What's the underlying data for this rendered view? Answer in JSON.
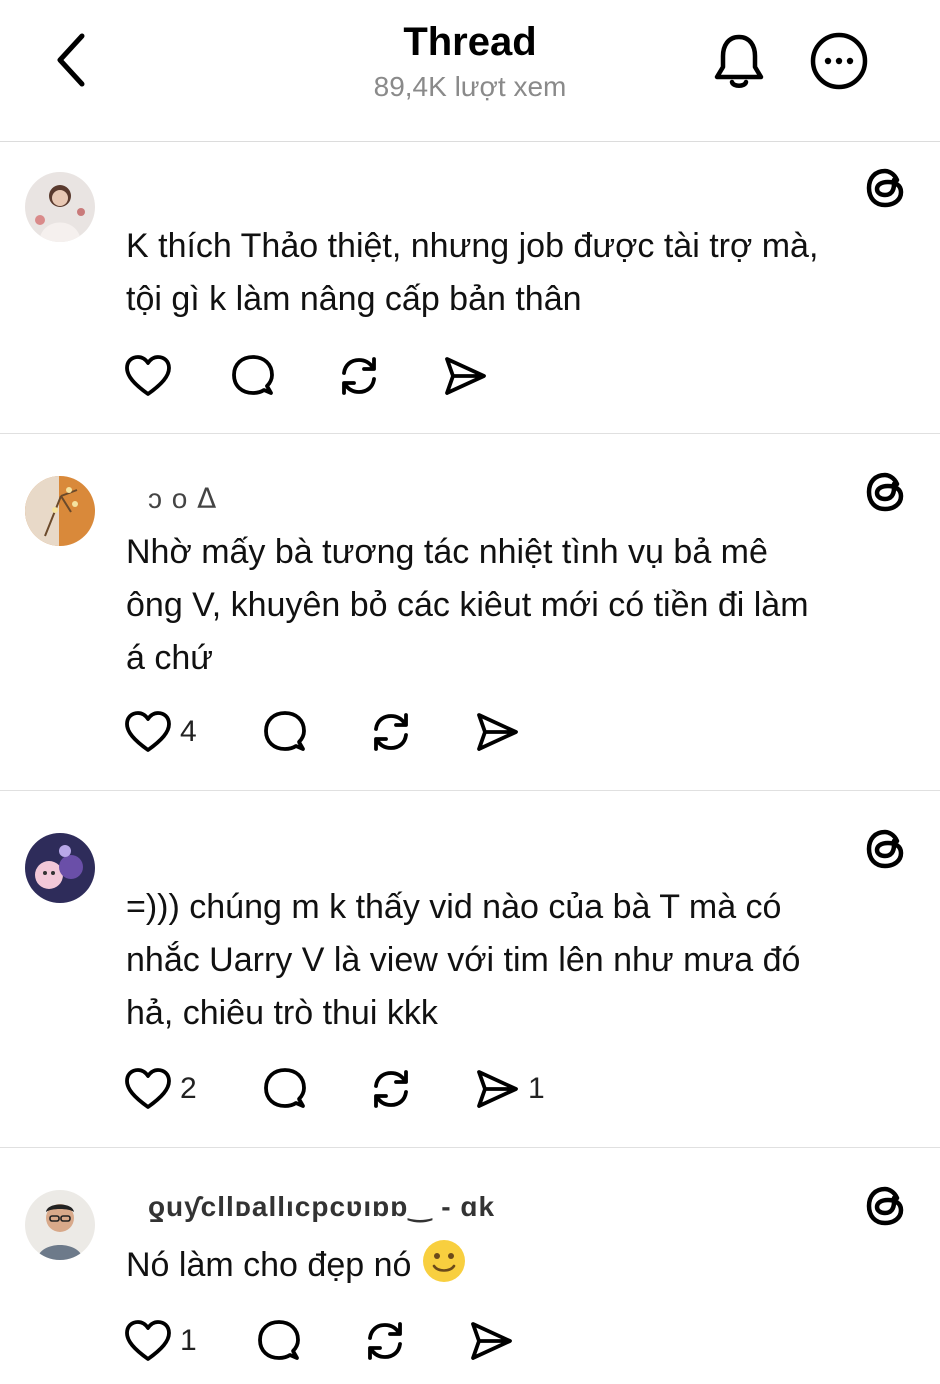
{
  "header": {
    "title": "Thread",
    "views": "89,4K lượt xem"
  },
  "posts": [
    {
      "username": "",
      "text_lines": [
        "K thích Thảo thiệt, nhưng job được tài trợ mà,",
        "tội gì k làm nâng cấp bản thân"
      ],
      "likes": "",
      "shares": ""
    },
    {
      "username": "ɔ         o       ᐃ",
      "text_lines": [
        "Nhờ mấy bà tương tác nhiệt tình vụ bả mê",
        "ông V, khuyên bỏ các kiêut mới có tiền đi làm",
        "á chứ"
      ],
      "likes": "4",
      "shares": ""
    },
    {
      "username": "",
      "text_lines": [
        "=))) chúng m k thấy vid nào của bà T mà có",
        "nhắc Uarry V là view với tim lên như mưa đó",
        "hả, chiêu trò thui kkk"
      ],
      "likes": "2",
      "shares": "1"
    },
    {
      "username": "ƍuƴcllᴅallıcpcʋıɒɒ‿ - ɑk",
      "text_lines": [
        "Nó làm cho đẹp nó"
      ],
      "likes": "1",
      "shares": ""
    }
  ],
  "icons": {
    "back": "chevron-left-icon",
    "bell": "bell-icon",
    "more": "more-icon",
    "threads": "threads-logo-icon",
    "like": "heart-icon",
    "comment": "comment-icon",
    "repost": "repost-icon",
    "share": "send-icon",
    "emoji": "slightly-smiling-face-icon"
  },
  "colors": {
    "text": "#111111",
    "muted": "#8a8a8a",
    "divider": "#e0e0e0"
  }
}
